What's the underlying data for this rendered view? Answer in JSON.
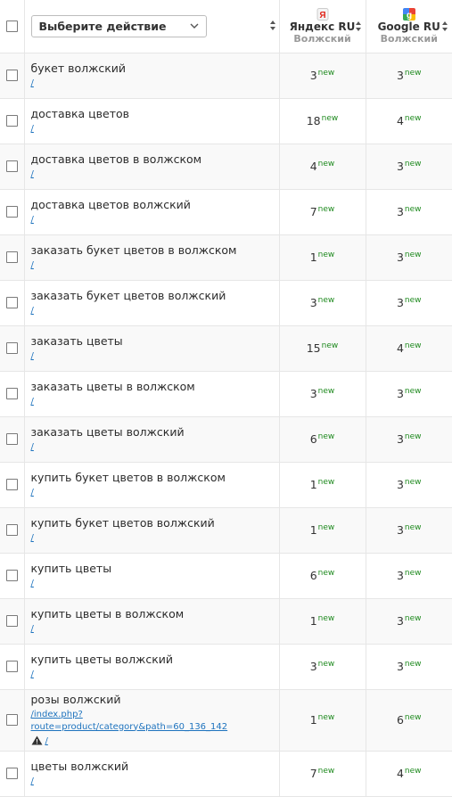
{
  "header": {
    "action_select": "Выберите действие",
    "engines": [
      {
        "name": "Яндекс RU",
        "sub": "Волжский",
        "icon": "yandex-icon"
      },
      {
        "name": "Google RU",
        "sub": "Волжский",
        "icon": "google-icon"
      }
    ]
  },
  "new_label": "new",
  "rows": [
    {
      "keyword": "букет волжский",
      "url": "/",
      "yandex": "3",
      "google": "3"
    },
    {
      "keyword": "доставка цветов",
      "url": "/",
      "yandex": "18",
      "google": "4"
    },
    {
      "keyword": "доставка цветов в волжском",
      "url": "/",
      "yandex": "4",
      "google": "3"
    },
    {
      "keyword": "доставка цветов волжский",
      "url": "/",
      "yandex": "7",
      "google": "3"
    },
    {
      "keyword": "заказать букет цветов в волжском",
      "url": "/",
      "yandex": "1",
      "google": "3"
    },
    {
      "keyword": "заказать букет цветов волжский",
      "url": "/",
      "yandex": "3",
      "google": "3"
    },
    {
      "keyword": "заказать цветы",
      "url": "/",
      "yandex": "15",
      "google": "4"
    },
    {
      "keyword": "заказать цветы в волжском",
      "url": "/",
      "yandex": "3",
      "google": "3"
    },
    {
      "keyword": "заказать цветы волжский",
      "url": "/",
      "yandex": "6",
      "google": "3"
    },
    {
      "keyword": "купить букет цветов в волжском",
      "url": "/",
      "yandex": "1",
      "google": "3"
    },
    {
      "keyword": "купить букет цветов волжский",
      "url": "/",
      "yandex": "1",
      "google": "3"
    },
    {
      "keyword": "купить цветы",
      "url": "/",
      "yandex": "6",
      "google": "3"
    },
    {
      "keyword": "купить цветы в волжском",
      "url": "/",
      "yandex": "1",
      "google": "3"
    },
    {
      "keyword": "купить цветы волжский",
      "url": "/",
      "yandex": "3",
      "google": "3"
    },
    {
      "keyword": "розы волжский",
      "url": "/index.php?route=product/category&path=60_136_142",
      "url2": "/",
      "yandex": "1",
      "google": "6"
    },
    {
      "keyword": "цветы волжский",
      "url": "/",
      "yandex": "7",
      "google": "4"
    }
  ]
}
